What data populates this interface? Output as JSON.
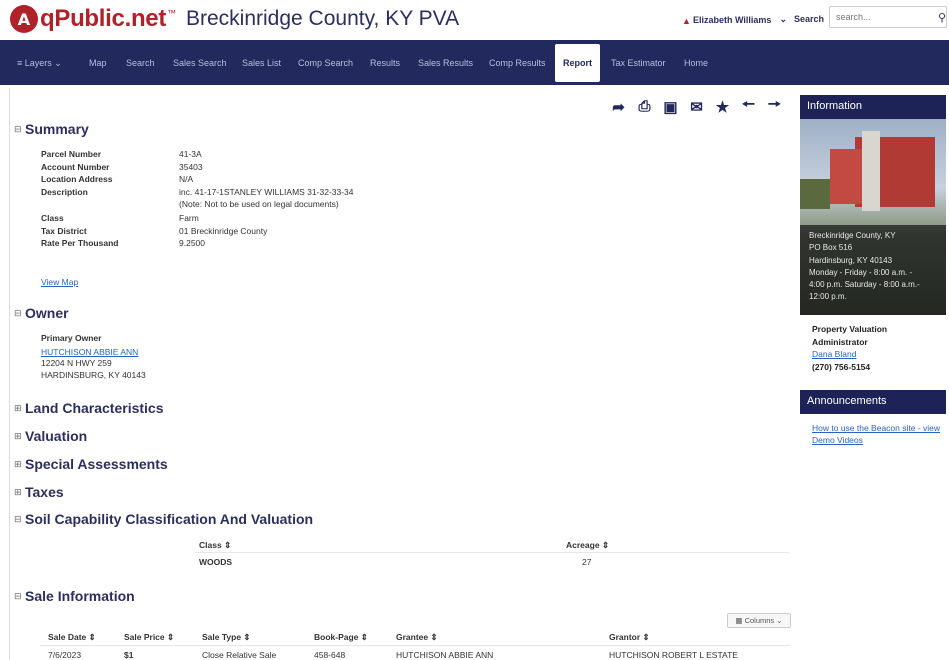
{
  "header": {
    "logo_badge": "A",
    "logo_text": "qPublic.net",
    "logo_tm": "™",
    "county_title": "Breckinridge County, KY PVA",
    "user_name": "Elizabeth Williams",
    "search_label": "Search",
    "search_placeholder": "search..."
  },
  "nav": {
    "items": [
      "Layers",
      "Map",
      "Search",
      "Sales Search",
      "Sales List",
      "Comp Search",
      "Results",
      "Sales Results",
      "Comp Results",
      "Report",
      "Tax Estimator",
      "Home"
    ],
    "active": "Report"
  },
  "toolbar": {
    "icons": [
      "share-icon",
      "print-icon",
      "image-icon",
      "email-icon",
      "star-icon",
      "arrow-left-icon",
      "arrow-right-icon"
    ]
  },
  "summary": {
    "title": "Summary",
    "rows": [
      {
        "label": "Parcel Number",
        "value": "41-3A"
      },
      {
        "label": "Account Number",
        "value": "35403"
      },
      {
        "label": "Location Address",
        "value": "N/A"
      },
      {
        "label": "Description",
        "value": "inc. 41-17-1STANLEY WILLIAMS 31-32-33-34"
      },
      {
        "label": "",
        "value": "(Note: Not to be used on legal documents)"
      },
      {
        "label": "Class",
        "value": "Farm"
      },
      {
        "label": "Tax District",
        "value": "01 Breckinridge County"
      },
      {
        "label": "Rate Per Thousand",
        "value": "9.2500"
      }
    ],
    "view_map": "View Map"
  },
  "owner": {
    "title": "Owner",
    "primary_owner_label": "Primary Owner",
    "owner_name": "HUTCHISON ABBIE ANN",
    "address1": "12204 N HWY 259",
    "address2": "HARDINSBURG, KY 40143"
  },
  "collapsed_sections": [
    "Land Characteristics",
    "Valuation",
    "Special Assessments",
    "Taxes"
  ],
  "soil": {
    "title": "Soil Capability Classification And Valuation",
    "headers": [
      "Class",
      "Acreage"
    ],
    "rows": [
      {
        "class": "WOODS",
        "acreage": "27"
      }
    ]
  },
  "sales": {
    "title": "Sale Information",
    "columns_button": "Columns",
    "headers": [
      "Sale Date",
      "Sale Price",
      "Sale Type",
      "Book-Page",
      "Grantee",
      "Grantor"
    ],
    "rows": [
      {
        "date": "7/6/2023",
        "price": "$1",
        "type": "Close Relative Sale",
        "book_page": "458-648",
        "grantee": "HUTCHISON ABBIE ANN",
        "grantor": "HUTCHISON ROBERT L ESTATE"
      }
    ]
  },
  "sidebar": {
    "information_title": "Information",
    "office_lines": [
      "Breckinridge County, KY",
      "PO Box 516",
      "Hardinsburg, KY 40143",
      "Monday - Friday - 8:00 a.m. -",
      "4:00 p.m. Saturday - 8:00 a.m.-",
      "12:00 p.m."
    ],
    "pva_title_1": "Property Valuation",
    "pva_title_2": "Administrator",
    "pva_name": "Dana Bland",
    "pva_phone": "(270) 756-5154",
    "announcements_title": "Announcements",
    "announcement_link": "How to use the Beacon site - view Demo Videos"
  },
  "colors": {
    "brand_red": "#b0222a",
    "nav_bg": "#22295c",
    "panel_bg": "#1d2357",
    "link": "#2a62c4",
    "note_red": "#d23c3c"
  }
}
